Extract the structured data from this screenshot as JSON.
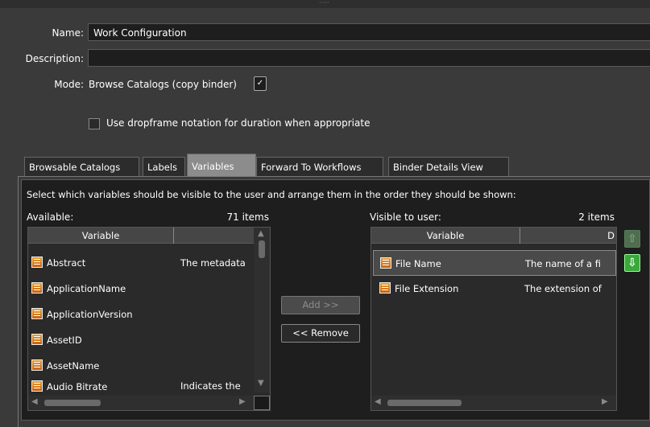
{
  "form": {
    "name_label": "Name:",
    "name_value": "Work Configuration",
    "description_label": "Description:",
    "description_value": "",
    "mode_label": "Mode:",
    "mode_value": "Browse Catalogs (copy binder)",
    "dropframe_label": "Use dropframe notation for duration when appropriate",
    "dropframe_checked": false
  },
  "tabs": [
    {
      "label": "Browsable Catalogs",
      "active": false
    },
    {
      "label": "Labels",
      "active": false
    },
    {
      "label": "Variables",
      "active": true
    },
    {
      "label": "Forward To Workflows",
      "active": false
    },
    {
      "label": "Binder Details View",
      "active": false
    }
  ],
  "variables": {
    "instructions": "Select which variables should be visible to the user and arrange them in the order they should be shown:",
    "available_label": "Available:",
    "available_count": "71 items",
    "visible_label": "Visible to user:",
    "visible_count": "2 items",
    "column_variable": "Variable",
    "column_description_partial": "D",
    "available_items": [
      {
        "name": "Abstract",
        "desc": "The metadata"
      },
      {
        "name": "ApplicationName",
        "desc": ""
      },
      {
        "name": "ApplicationVersion",
        "desc": ""
      },
      {
        "name": "AssetID",
        "desc": ""
      },
      {
        "name": "AssetName",
        "desc": ""
      },
      {
        "name": "Audio Bitrate",
        "desc": "Indicates the"
      }
    ],
    "visible_items": [
      {
        "name": "File Name",
        "desc": "The name of a fi",
        "selected": true
      },
      {
        "name": "File Extension",
        "desc": "The extension of",
        "selected": false
      }
    ],
    "add_button": "Add >>",
    "remove_button": "<< Remove",
    "move_up_icon": "green-up-arrow",
    "move_down_icon": "green-down-arrow"
  }
}
